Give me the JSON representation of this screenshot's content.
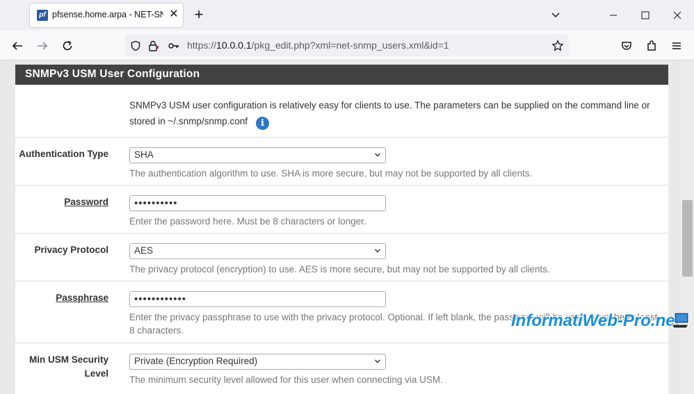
{
  "browser": {
    "tab_title": "pfsense.home.arpa - NET-SNMP",
    "favicon_text": "pf",
    "url_prefix": "https://",
    "url_host": "10.0.0.1",
    "url_path": "/pkg_edit.php?xml=net-snmp_users.xml&id=1"
  },
  "panel": {
    "heading": "SNMPv3 USM User Configuration",
    "description": "SNMPv3 USM user configuration is relatively easy for clients to use. The parameters can be supplied on the command line or stored in ~/.snmp/snmp.conf"
  },
  "fields": {
    "auth_type": {
      "label": "Authentication Type",
      "value": "SHA",
      "help": "The authentication algorithm to use. SHA is more secure, but may not be supported by all clients."
    },
    "password": {
      "label": "Password",
      "value": "••••••••••",
      "help": "Enter the password here. Must be 8 characters or longer."
    },
    "privacy_protocol": {
      "label": "Privacy Protocol",
      "value": "AES",
      "help": "The privacy protocol (encryption) to use. AES is more secure, but may not be supported by all clients."
    },
    "passphrase": {
      "label": "Passphrase",
      "value": "••••••••••••",
      "help": "Enter the privacy passphrase to use with the privacy protocol. Optional. If left blank, the password will be used. Must be at least 8 characters."
    },
    "min_security": {
      "label_line1": "Min USM Security",
      "label_line2": "Level",
      "value": "Private (Encryption Required)",
      "help": "The minimum security level allowed for this user when connecting via USM."
    }
  },
  "watermark": "InformatiWeb-Pro.net",
  "colors": {
    "heading_bg": "#424242",
    "info_icon": "#2e77c2",
    "watermark": "#1a8ed6"
  }
}
